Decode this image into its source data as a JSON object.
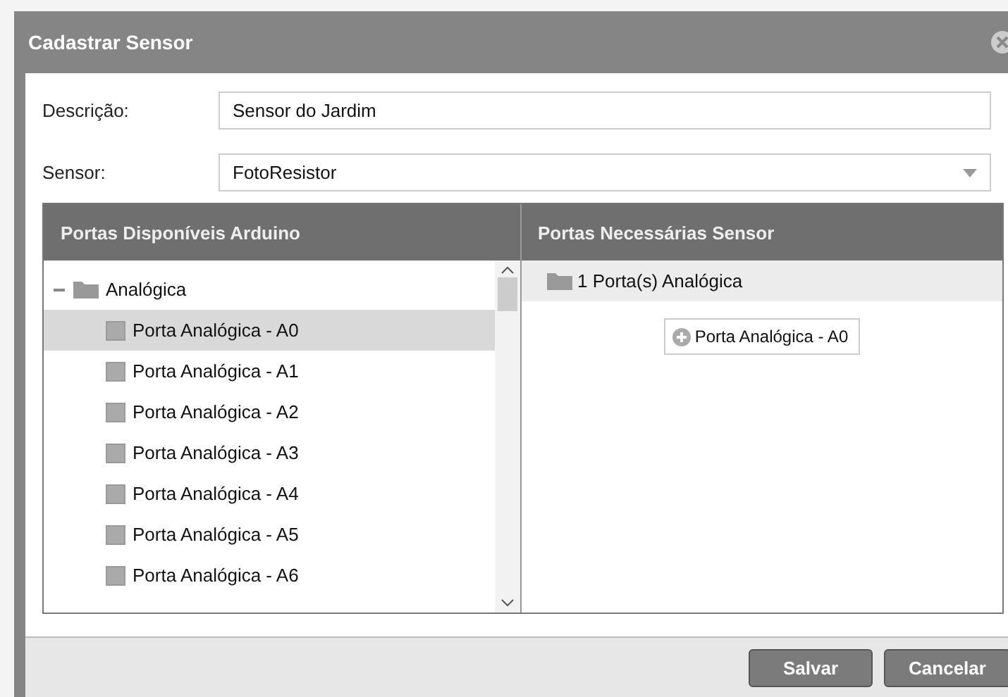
{
  "window": {
    "title": "Cadastrar Sensor"
  },
  "form": [
    {
      "kind": "text",
      "label": "Descrição:",
      "value": "Sensor do Jardim"
    },
    {
      "kind": "select",
      "label": "Sensor:",
      "value": "FotoResistor"
    }
  ],
  "available": {
    "title": "Portas Disponíveis Arduino",
    "tree": [
      {
        "label": "Analógica",
        "expanded": true,
        "children": [
          {
            "label": "Porta Analógica - A0",
            "selected": true
          },
          {
            "label": "Porta Analógica - A1",
            "selected": false
          },
          {
            "label": "Porta Analógica - A2",
            "selected": false
          },
          {
            "label": "Porta Analógica - A3",
            "selected": false
          },
          {
            "label": "Porta Analógica - A4",
            "selected": false
          },
          {
            "label": "Porta Analógica - A5",
            "selected": false
          },
          {
            "label": "Porta Analógica - A6",
            "selected": false
          }
        ]
      }
    ]
  },
  "required": {
    "title": "Portas Necessárias Sensor",
    "group": "1 Porta(s) Analógica",
    "slots": [
      "Porta Analógica - A0"
    ]
  },
  "buttons": [
    "Salvar",
    "Cancelar"
  ]
}
